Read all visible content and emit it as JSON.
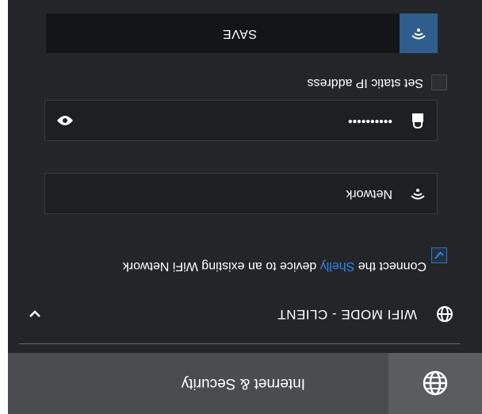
{
  "header": {
    "title": "Internet & Security",
    "icon": "globe-icon"
  },
  "section": {
    "title": "WIFI MODE - CLIENT",
    "icon": "globe-icon",
    "chevron_icon": "chevron-down-icon"
  },
  "connect": {
    "checked": true,
    "text_before": "Connect the ",
    "text_brand": "Shelly",
    "text_after": " device to an existing WiFi Network"
  },
  "network_field": {
    "icon": "wifi-icon",
    "value": "Network"
  },
  "password_field": {
    "icon": "lock-icon",
    "value": "••••••••••",
    "toggle_icon": "eye-icon"
  },
  "static_ip": {
    "checked": false,
    "label": "Set static IP address"
  },
  "save": {
    "icon": "wifi-icon",
    "label": "SAVE"
  },
  "colors": {
    "background": "#232528",
    "header": "#4a4c50",
    "accent": "#2f5e8c",
    "brand": "#2f86e8"
  }
}
